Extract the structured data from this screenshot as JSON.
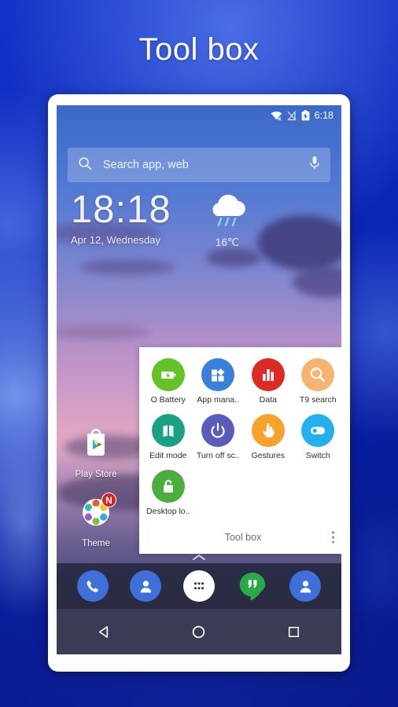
{
  "page": {
    "title": "Tool box",
    "background_color": "#0d2bbe"
  },
  "phone": {
    "status_bar": {
      "time": "6:18",
      "icons": [
        "wifi-off-icon",
        "signal-off-icon",
        "battery-icon"
      ]
    },
    "search": {
      "placeholder": "Search app, web",
      "value": "",
      "left_icon": "search-icon",
      "right_icon": "microphone-icon"
    },
    "clock_widget": {
      "time": "18:18",
      "date": "Apr 12, Wednesday",
      "weather_icon": "rain-cloud-icon",
      "temperature": "16℃"
    },
    "desktop_icons": [
      {
        "label": "Play Store",
        "icon": "play-store-icon",
        "badge": ""
      },
      {
        "label": "Theme",
        "icon": "theme-icon",
        "badge": "N"
      }
    ],
    "toolbox": {
      "footer_label": "Tool box",
      "overflow_icon": "more-vertical-icon",
      "items": [
        {
          "label": "O Battery",
          "icon": "battery-boost-icon",
          "color": "#65c228"
        },
        {
          "label": "App mana..",
          "icon": "app-manager-icon",
          "color": "#3880d8"
        },
        {
          "label": "Data",
          "icon": "data-usage-icon",
          "color": "#dc2a24"
        },
        {
          "label": "T9 search",
          "icon": "t9-search-icon",
          "color": "#f6b470"
        },
        {
          "label": "Edit mode",
          "icon": "edit-mode-icon",
          "color": "#1aa083"
        },
        {
          "label": "Turn off sc..",
          "icon": "power-off-icon",
          "color": "#5b5bb9"
        },
        {
          "label": "Gestures",
          "icon": "hand-gesture-icon",
          "color": "#f7a32b"
        },
        {
          "label": "Switch",
          "icon": "toggle-switch-icon",
          "color": "#24b0ef"
        },
        {
          "label": "Desktop lo..",
          "icon": "unlock-icon",
          "color": "#4aad3c"
        }
      ]
    },
    "dock_handle_icon": "chevron-up-icon",
    "dock": [
      {
        "name": "phone",
        "icon": "phone-icon",
        "color": "#3f6fd8"
      },
      {
        "name": "contacts",
        "icon": "person-icon",
        "color": "#3f6fd8"
      },
      {
        "name": "app-drawer",
        "icon": "app-drawer-icon",
        "color": "#ffffff"
      },
      {
        "name": "hangouts",
        "icon": "hangouts-icon",
        "color": "#2aa84a"
      },
      {
        "name": "people",
        "icon": "person-icon",
        "color": "#3f6fd8"
      }
    ],
    "nav_bar": [
      {
        "name": "back",
        "icon": "back-triangle-icon"
      },
      {
        "name": "home",
        "icon": "home-circle-icon"
      },
      {
        "name": "recents",
        "icon": "recents-square-icon"
      }
    ]
  }
}
